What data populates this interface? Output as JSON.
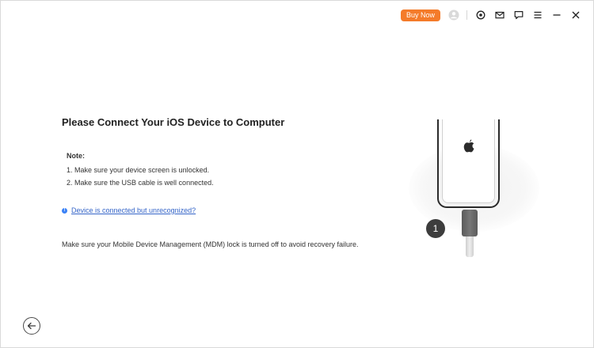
{
  "header": {
    "buy_now_label": "Buy Now",
    "icons": [
      "account-icon",
      "target-icon",
      "mail-icon",
      "feedback-icon",
      "menu-icon",
      "minimize-icon",
      "close-icon"
    ]
  },
  "main": {
    "title": "Please Connect Your iOS Device to Computer",
    "note_title": "Note:",
    "notes": [
      "1. Make sure your device screen is unlocked.",
      "2. Make sure the USB cable is well connected."
    ],
    "help_link": "Device is connected but unrecognized?",
    "mdm_text": "Make sure your Mobile Device Management (MDM) lock is turned off to avoid recovery failure."
  },
  "illustration": {
    "step_number": "1"
  },
  "footer": {
    "back_icon": "back-arrow-icon"
  },
  "colors": {
    "accent": "#f47b2a",
    "link": "#3565c8",
    "info_dot": "#3b82f6"
  }
}
